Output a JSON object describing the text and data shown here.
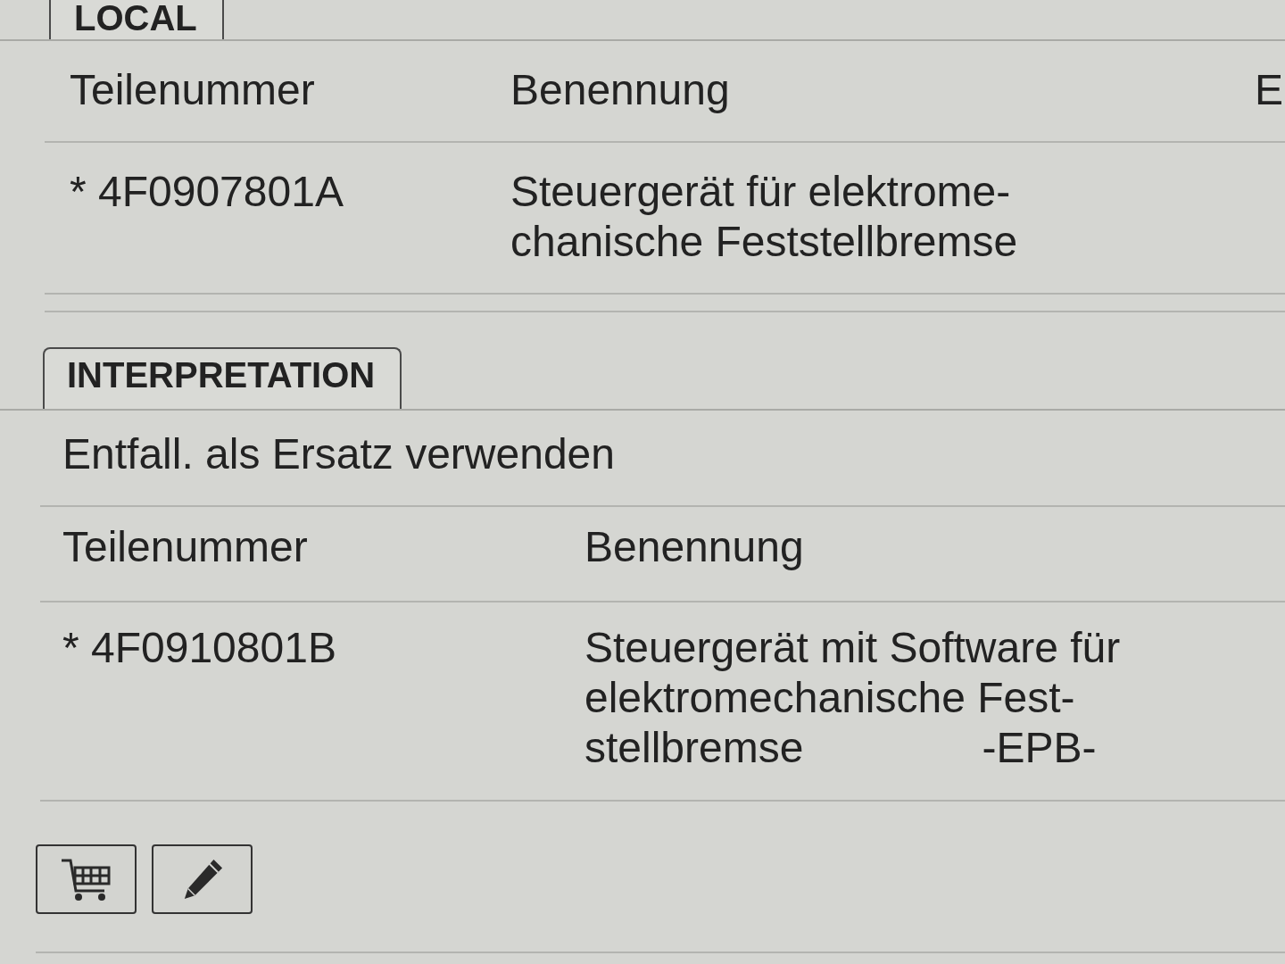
{
  "sections": [
    {
      "tab": {
        "label": "LOCAL"
      },
      "table": {
        "columns": [
          "Teilenummer",
          "Benennung",
          "E"
        ],
        "rows": [
          {
            "part_number": "* 4F0907801A",
            "description": "Steuergerät für elektrome-\nchanische Feststellbremse"
          }
        ]
      }
    },
    {
      "tab": {
        "label": "INTERPRETATION"
      },
      "note": "Entfall. als Ersatz verwenden",
      "table": {
        "columns": [
          "Teilenummer",
          "Benennung"
        ],
        "rows": [
          {
            "part_number": "* 4F0910801B",
            "description": "Steuergerät mit Software für\nelektromechanische Fest-\nstellbremse               -EPB-"
          }
        ]
      }
    }
  ],
  "actions": [
    {
      "kind": "cart"
    },
    {
      "kind": "edit"
    }
  ]
}
